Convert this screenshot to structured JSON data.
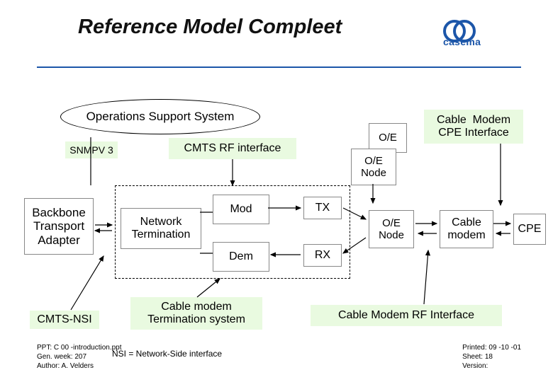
{
  "title": "Reference Model Compleet",
  "logo": {
    "brand": "casema"
  },
  "top": {
    "oss": "Operations Support System",
    "snmpv3": "SNMPV 3",
    "cmts_rf_if": "CMTS RF interface",
    "oe_top": "O/E",
    "oe_node_top": "O/E\nNode",
    "cm_cpe_if": "Cable  Modem\nCPE Interface"
  },
  "mid": {
    "backbone": "Backbone\nTransport\nAdapter",
    "net_term": "Network\nTermination",
    "mod": "Mod",
    "dem": "Dem",
    "tx": "TX",
    "rx": "RX",
    "oe_node": "O/E\nNode",
    "cable_modem": "Cable\nmodem",
    "cpe": "CPE"
  },
  "bottom": {
    "cmts_nsi": "CMTS-NSI",
    "cm_term_sys": "Cable modem\nTermination system",
    "cm_rf_if": "Cable  Modem RF Interface"
  },
  "footer": {
    "ppt": "PPT: C 00 -introduction.ppt",
    "week": "Gen. week: 207",
    "author": "Author: A. Velders",
    "nsi": "NSI = Network-Side interface",
    "printed": "Printed: 09 -10 -01",
    "sheet": "Sheet: 18",
    "version": "Version:"
  }
}
